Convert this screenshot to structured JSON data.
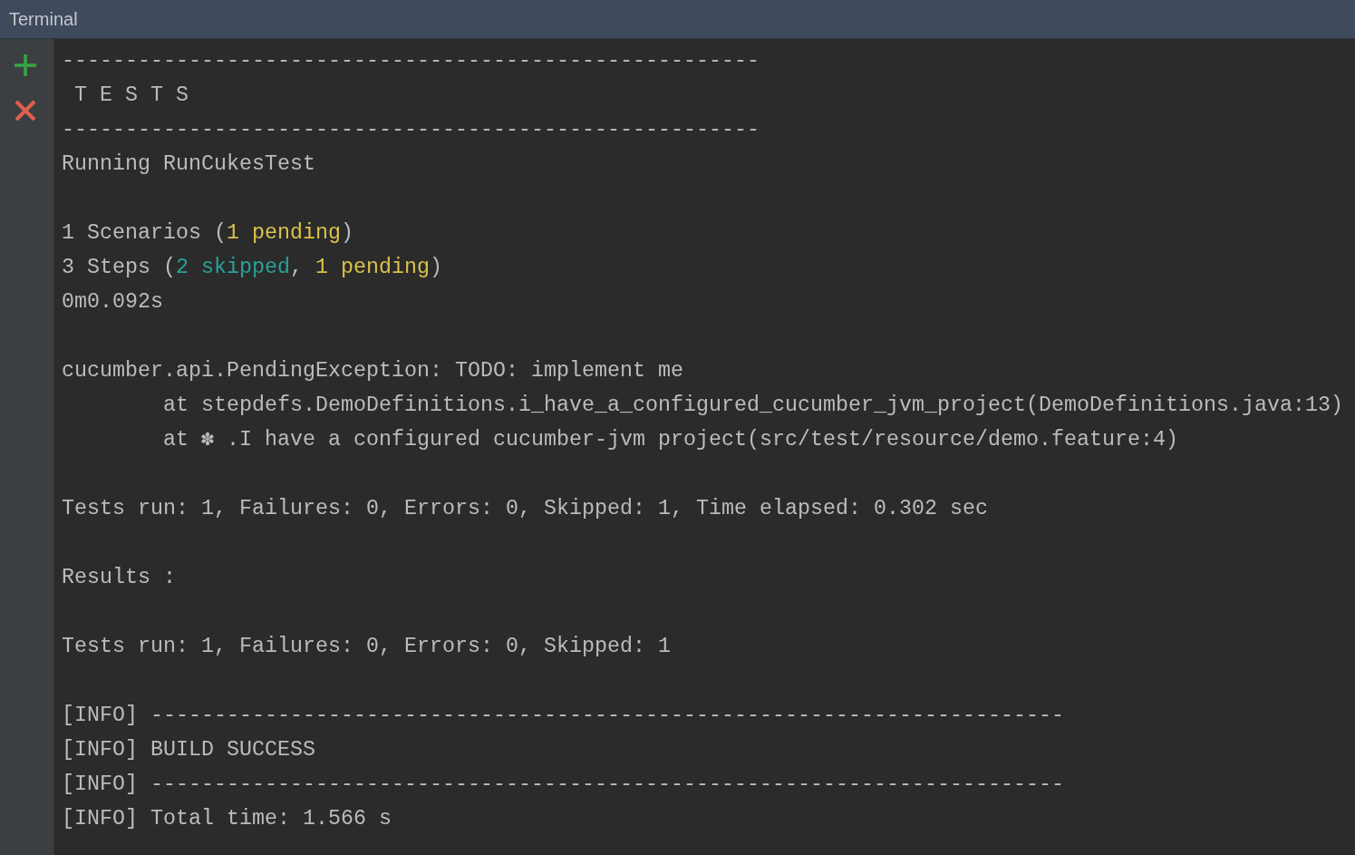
{
  "window": {
    "title": "Terminal"
  },
  "blocks": [
    {
      "lines": [
        {
          "kind": "text",
          "text": "-------------------------------------------------------"
        },
        {
          "kind": "heading",
          "text": "T E S T S"
        },
        {
          "kind": "text",
          "text": "-------------------------------------------------------"
        },
        {
          "kind": "text",
          "text": "Running RunCukesTest"
        }
      ]
    },
    {
      "lines": [
        {
          "kind": "text",
          "segments": [
            {
              "text": "1 Scenarios (",
              "color": "#bbbbbb"
            },
            {
              "text": "1 pending",
              "color": "#d9c24b"
            },
            {
              "text": ")",
              "color": "#bbbbbb"
            }
          ]
        },
        {
          "kind": "text",
          "segments": [
            {
              "text": "3 Steps (",
              "color": "#bbbbbb"
            },
            {
              "text": "2 skipped",
              "color": "#2aa198"
            },
            {
              "text": ", ",
              "color": "#bbbbbb"
            },
            {
              "text": "1 pending",
              "color": "#d9c24b"
            },
            {
              "text": ")",
              "color": "#bbbbbb"
            }
          ]
        },
        {
          "kind": "text",
          "text": "0m0.092s"
        }
      ]
    },
    {
      "lines": [
        {
          "kind": "text",
          "text": "cucumber.api.PendingException: TODO: implement me",
          "children": [
            {
              "kind": "text",
              "text": "at stepdefs.DemoDefinitions.i_have_a_configured_cucumber_jvm_project(DemoDefinitions.java:13)"
            },
            {
              "kind": "text",
              "text": "at ✽ .I have a configured cucumber-jvm project(src/test/resource/demo.feature:4)"
            }
          ]
        }
      ]
    },
    {
      "lines": [
        {
          "kind": "text",
          "text": "Tests run: 1, Failures: 0, Errors: 0, Skipped: 1, Time elapsed: 0.302 sec"
        }
      ]
    },
    {
      "lines": [
        {
          "kind": "text",
          "text": "Results :"
        }
      ]
    },
    {
      "lines": [
        {
          "kind": "text",
          "text": "Tests run: 1, Failures: 0, Errors: 0, Skipped: 1"
        }
      ]
    },
    {
      "lines": [
        {
          "kind": "text",
          "text": "[INFO] ------------------------------------------------------------------------"
        },
        {
          "kind": "text",
          "text": "[INFO] BUILD SUCCESS"
        },
        {
          "kind": "text",
          "text": "[INFO] ------------------------------------------------------------------------"
        },
        {
          "kind": "text",
          "text": "[INFO] Total time: 1.566 s"
        }
      ]
    }
  ]
}
